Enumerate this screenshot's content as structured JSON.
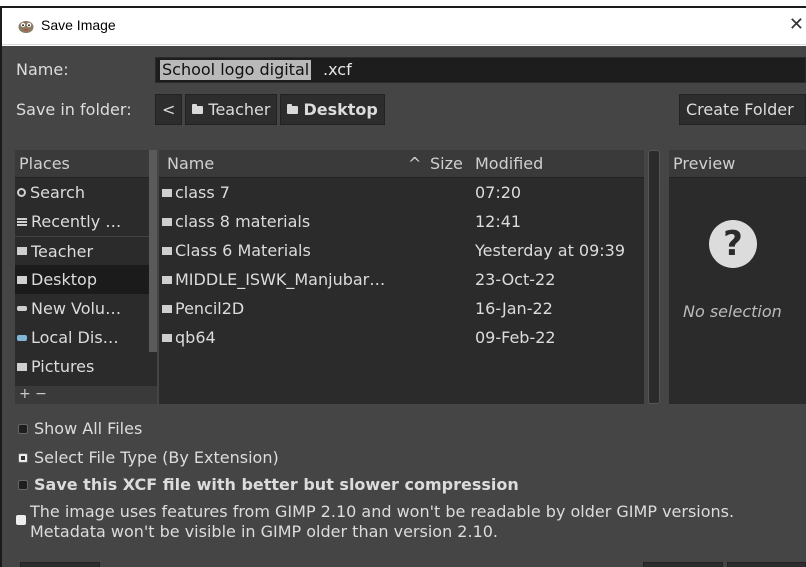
{
  "window": {
    "title": "Save Image",
    "close_glyph": "✕"
  },
  "name_row": {
    "label": "Name:",
    "filename_selected": "School logo digital",
    "filename_ext": ".xcf"
  },
  "folder_row": {
    "label": "Save in folder:",
    "back_glyph": "<",
    "crumbs": [
      "Teacher",
      "Desktop"
    ],
    "create_folder": "Create Folder"
  },
  "places": {
    "header": "Places",
    "items": [
      {
        "label": "Search",
        "icon": "search-icon"
      },
      {
        "label": "Recently …",
        "icon": "recent-icon"
      },
      {
        "label": "Teacher",
        "icon": "folder-icon"
      },
      {
        "label": "Desktop",
        "icon": "folder-icon",
        "selected": true
      },
      {
        "label": "New Volu…",
        "icon": "drive-icon"
      },
      {
        "label": "Local Dis…",
        "icon": "drive-icon"
      },
      {
        "label": "Pictures",
        "icon": "folder-icon"
      }
    ],
    "add_remove": "+ −"
  },
  "files": {
    "columns": {
      "name": "Name",
      "sort_glyph": "^",
      "size": "Size",
      "modified": "Modified"
    },
    "rows": [
      {
        "name": "class 7",
        "modified": "07:20"
      },
      {
        "name": "class 8 materials",
        "modified": "12:41"
      },
      {
        "name": "Class 6 Materials",
        "modified": "Yesterday at 09:39"
      },
      {
        "name": "MIDDLE_ISWK_Manjubar…",
        "modified": "23-Oct-22"
      },
      {
        "name": "Pencil2D",
        "modified": "16-Jan-22"
      },
      {
        "name": "qb64",
        "modified": "09-Feb-22"
      }
    ]
  },
  "preview": {
    "header": "Preview",
    "glyph": "?",
    "empty_text": "No selection"
  },
  "options": {
    "show_all": "Show All Files",
    "file_type": "Select File Type (By Extension)",
    "compression": "Save this XCF file with better but slower compression"
  },
  "warning": {
    "line1": "The image uses features from GIMP 2.10 and won't be readable by older GIMP versions.",
    "line2": "Metadata won't be visible in GIMP older than version 2.10."
  },
  "colors": {
    "dialog_bg": "#454545",
    "panel_bg": "#2b2b2b",
    "selected_row": "#1b1b1b"
  }
}
